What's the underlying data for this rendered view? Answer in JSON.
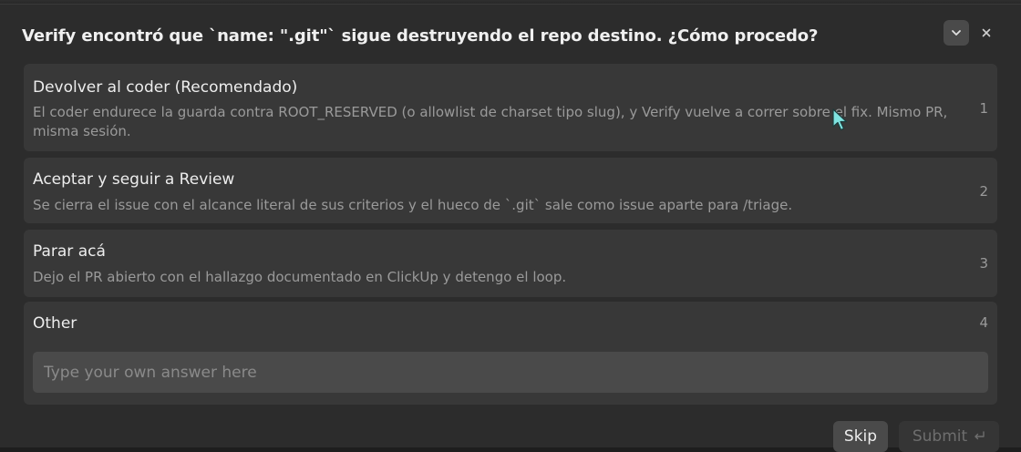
{
  "dialog": {
    "title": "Verify encontró que `name: \".git\"` sigue destruyendo el repo destino. ¿Cómo procedo?"
  },
  "options": [
    {
      "label": "Devolver al coder (Recomendado)",
      "description": "El coder endurece la guarda contra ROOT_RESERVED (o allowlist de charset tipo slug), y Verify vuelve a correr sobre el fix. Mismo PR, misma sesión.",
      "number": "1"
    },
    {
      "label": "Aceptar y seguir a Review",
      "description": "Se cierra el issue con el alcance literal de sus criterios y el hueco de `.git` sale como issue aparte para /triage.",
      "number": "2"
    },
    {
      "label": "Parar acá",
      "description": "Dejo el PR abierto con el hallazgo documentado en ClickUp y detengo el loop.",
      "number": "3"
    },
    {
      "label": "Other",
      "number": "4",
      "input_value": "",
      "input_placeholder": "Type your own answer here"
    }
  ],
  "footer": {
    "skip_label": "Skip",
    "submit_label": "Submit",
    "submit_icon": "enter-key-icon"
  },
  "icons": {
    "collapse": "chevron-down-icon",
    "close": "close-icon",
    "cursor": "mouse-cursor-icon"
  },
  "colors": {
    "background": "#2c2c2c",
    "option_bg": "#383838",
    "input_bg": "#4a4a4a",
    "cursor": "#7fe3e0"
  }
}
